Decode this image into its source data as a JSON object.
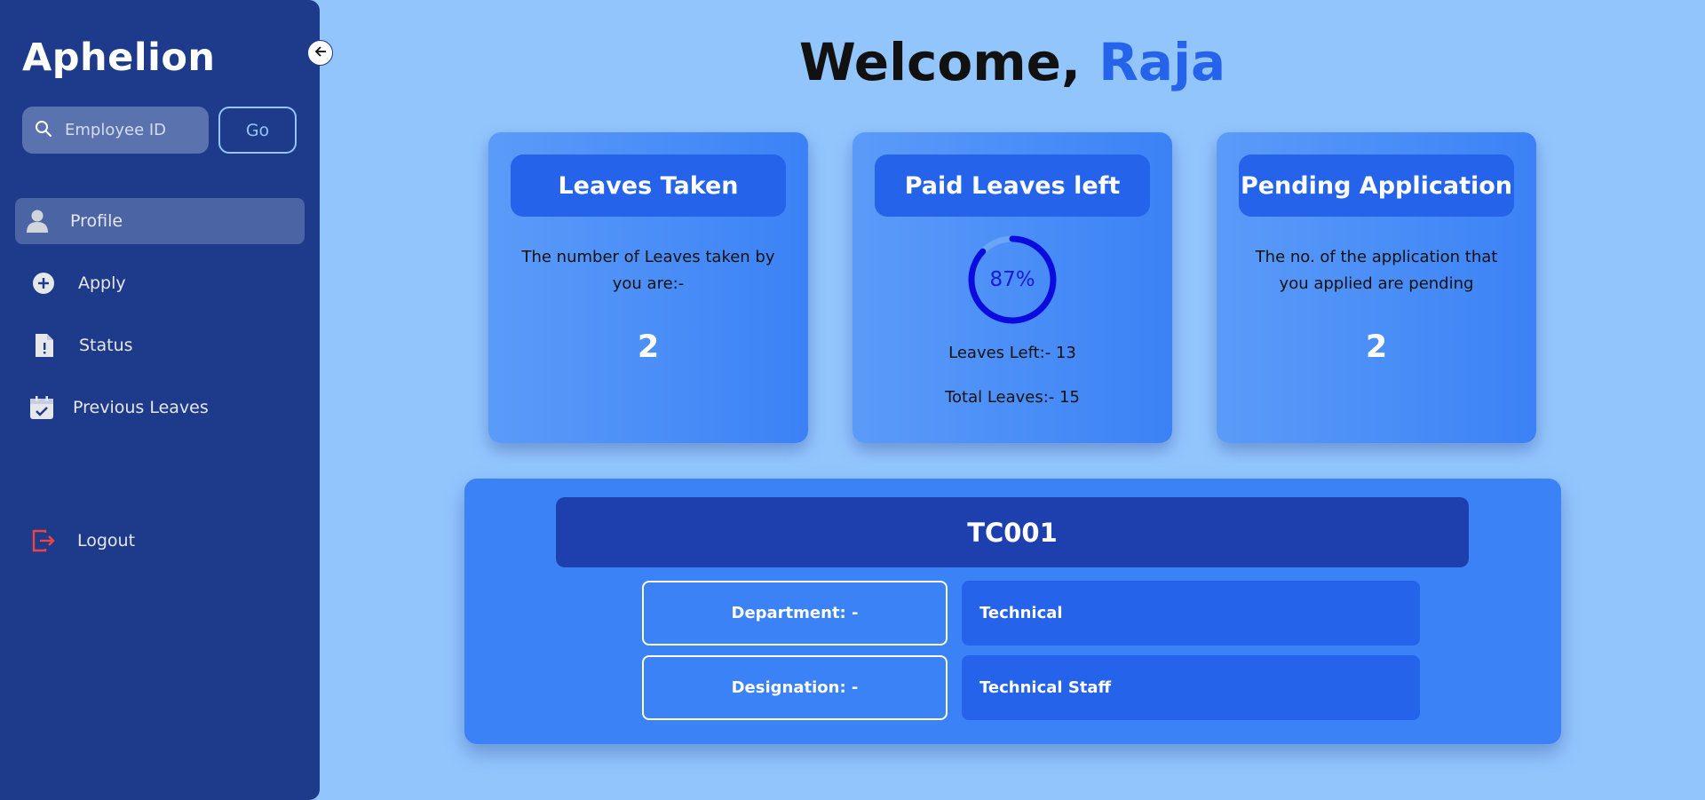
{
  "sidebar": {
    "brand": "Aphelion",
    "search": {
      "placeholder": "Employee ID",
      "value": ""
    },
    "go_label": "Go",
    "nav": [
      {
        "label": "Profile",
        "icon": "user-icon",
        "active": true
      },
      {
        "label": "Apply",
        "icon": "plus-circle-icon",
        "active": false
      },
      {
        "label": "Status",
        "icon": "document-alert-icon",
        "active": false
      },
      {
        "label": "Previous Leaves",
        "icon": "calendar-check-icon",
        "active": false
      }
    ],
    "logout_label": "Logout"
  },
  "header": {
    "greeting": "Welcome,",
    "name": "Raja"
  },
  "cards": {
    "leaves_taken": {
      "title": "Leaves Taken",
      "description": "The number of Leaves taken by you are:-",
      "value": "2"
    },
    "paid_leaves": {
      "title": "Paid Leaves left",
      "percent_label": "87%",
      "percent": 87,
      "leaves_left": "Leaves Left:- 13",
      "total_leaves": "Total Leaves:- 15"
    },
    "pending": {
      "title": "Pending Application",
      "description": "The no. of the application that you applied are pending",
      "value": "2"
    }
  },
  "profile": {
    "employee_id": "TC001",
    "department_label": "Department: -",
    "department_value": "Technical",
    "designation_label": "Designation: -",
    "designation_value": "Technical Staff"
  },
  "colors": {
    "sidebar_bg": "#1e3a8a",
    "page_bg": "#93c5fd",
    "accent": "#2563eb",
    "ring": "#0b0be0",
    "logout": "#ef4444"
  }
}
